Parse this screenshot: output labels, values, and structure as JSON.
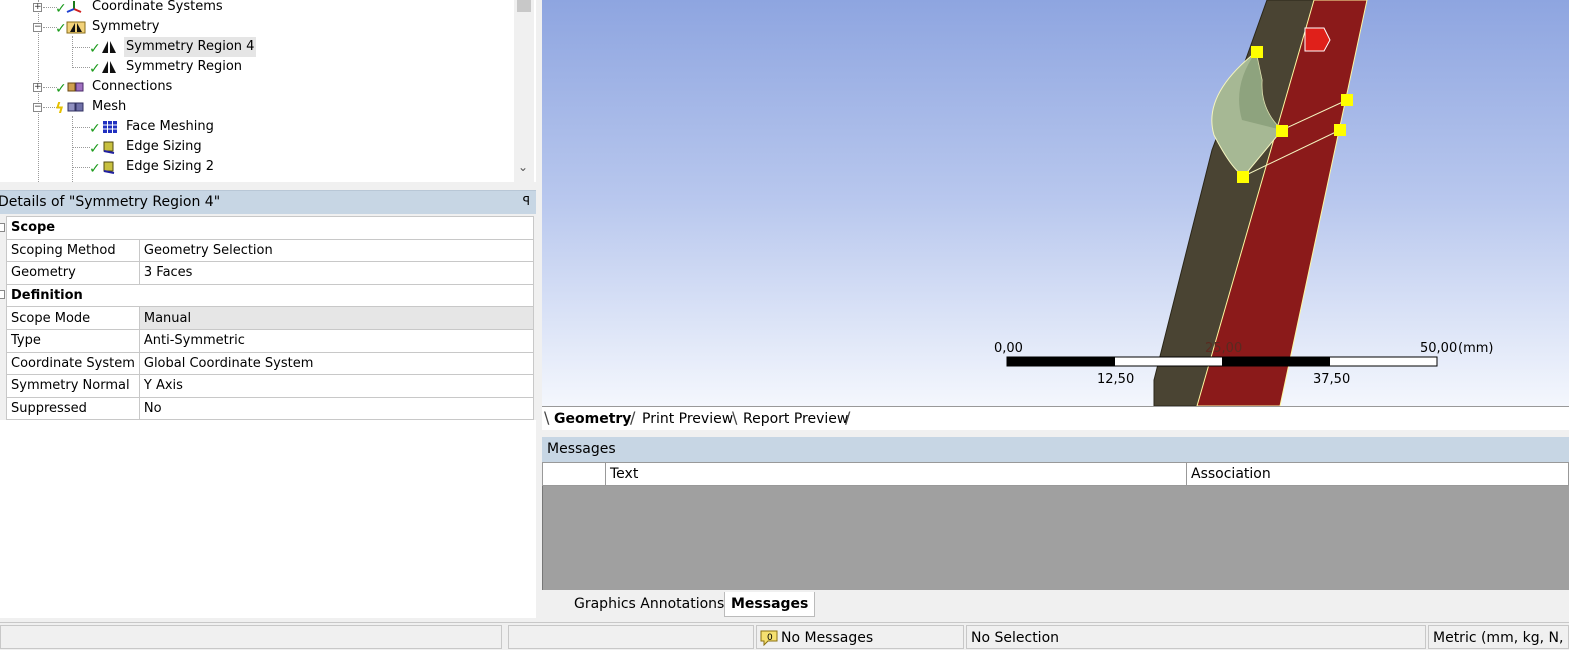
{
  "tree": {
    "items": [
      {
        "label": "Coordinate Systems",
        "icon": "coordinate-systems-icon"
      },
      {
        "label": "Symmetry",
        "icon": "symmetry-folder-icon"
      },
      {
        "label": "Symmetry Region 4",
        "icon": "symmetry-region-icon"
      },
      {
        "label": "Symmetry Region",
        "icon": "symmetry-region-icon"
      },
      {
        "label": "Connections",
        "icon": "connections-icon"
      },
      {
        "label": "Mesh",
        "icon": "mesh-icon"
      },
      {
        "label": "Face Meshing",
        "icon": "face-meshing-icon"
      },
      {
        "label": "Edge Sizing",
        "icon": "edge-sizing-icon"
      },
      {
        "label": "Edge Sizing 2",
        "icon": "edge-sizing-icon"
      }
    ]
  },
  "details": {
    "title": "Details of \"Symmetry Region 4\"",
    "pin": "ꟼ",
    "sections": {
      "scope": "Scope",
      "definition": "Definition"
    },
    "rows": {
      "scoping_method": {
        "key": "Scoping Method",
        "value": "Geometry Selection"
      },
      "geometry": {
        "key": "Geometry",
        "value": "3 Faces"
      },
      "scope_mode": {
        "key": "Scope Mode",
        "value": "Manual"
      },
      "type": {
        "key": "Type",
        "value": "Anti-Symmetric"
      },
      "coordinate_system": {
        "key": "Coordinate System",
        "value": "Global Coordinate System"
      },
      "symmetry_normal": {
        "key": "Symmetry Normal",
        "value": "Y Axis"
      },
      "suppressed": {
        "key": "Suppressed",
        "value": "No"
      }
    }
  },
  "scale_bar": {
    "top_labels": [
      "0,00",
      "25,00",
      "50,00"
    ],
    "bottom_labels": [
      "12,50",
      "37,50"
    ],
    "unit": "(mm)"
  },
  "view_tabs": [
    "Geometry",
    "Print Preview",
    "Report Preview"
  ],
  "messages": {
    "title": "Messages",
    "columns": [
      "Text",
      "Association"
    ]
  },
  "bottom_tabs": [
    "Graphics Annotations",
    "Messages"
  ],
  "status": {
    "messages": "No Messages",
    "message_count": "0",
    "selection": "No Selection",
    "units": "Metric (mm, kg, N, s,"
  },
  "colors": {
    "viewport_top": "#8ea5e0",
    "selected_face": "#8b1a1a",
    "body_face": "#4a4433",
    "vertex_marker": "#ffff00",
    "panel_header": "#c7d6e4",
    "message_body": "#a0a0a0"
  }
}
